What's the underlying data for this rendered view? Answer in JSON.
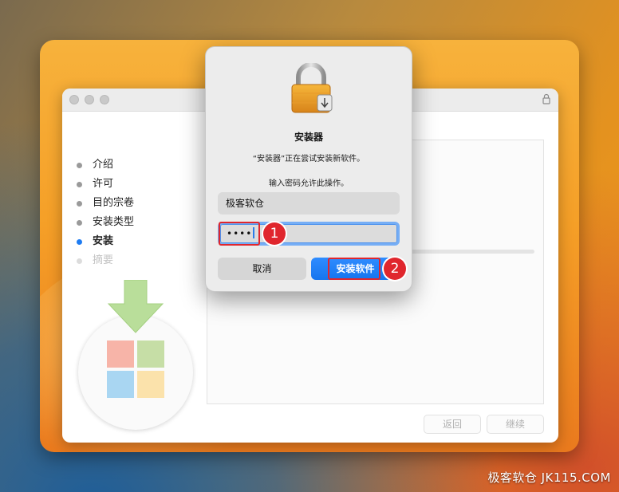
{
  "installer": {
    "steps": [
      {
        "label": "介绍",
        "state": "done"
      },
      {
        "label": "许可",
        "state": "done"
      },
      {
        "label": "目的宗卷",
        "state": "done"
      },
      {
        "label": "安装类型",
        "state": "done"
      },
      {
        "label": "安装",
        "state": "active"
      },
      {
        "label": "摘要",
        "state": "disabled"
      }
    ],
    "back_label": "返回",
    "continue_label": "继续"
  },
  "auth_dialog": {
    "title": "安装器",
    "message": "“安装器”正在尝试安装新软件。",
    "prompt": "输入密码允许此操作。",
    "username": "极客软仓",
    "password_masked": "••••",
    "cancel_label": "取消",
    "install_label": "安装软件"
  },
  "annotations": {
    "step1": "1",
    "step2": "2"
  },
  "watermark": "极客软仓 JK115.COM",
  "colors": {
    "accent": "#1e7cf2",
    "highlight": "#e0262d",
    "package_tiles": [
      "#f7b4a8",
      "#c6dea6",
      "#a9d6f2",
      "#fbe2ab"
    ]
  }
}
